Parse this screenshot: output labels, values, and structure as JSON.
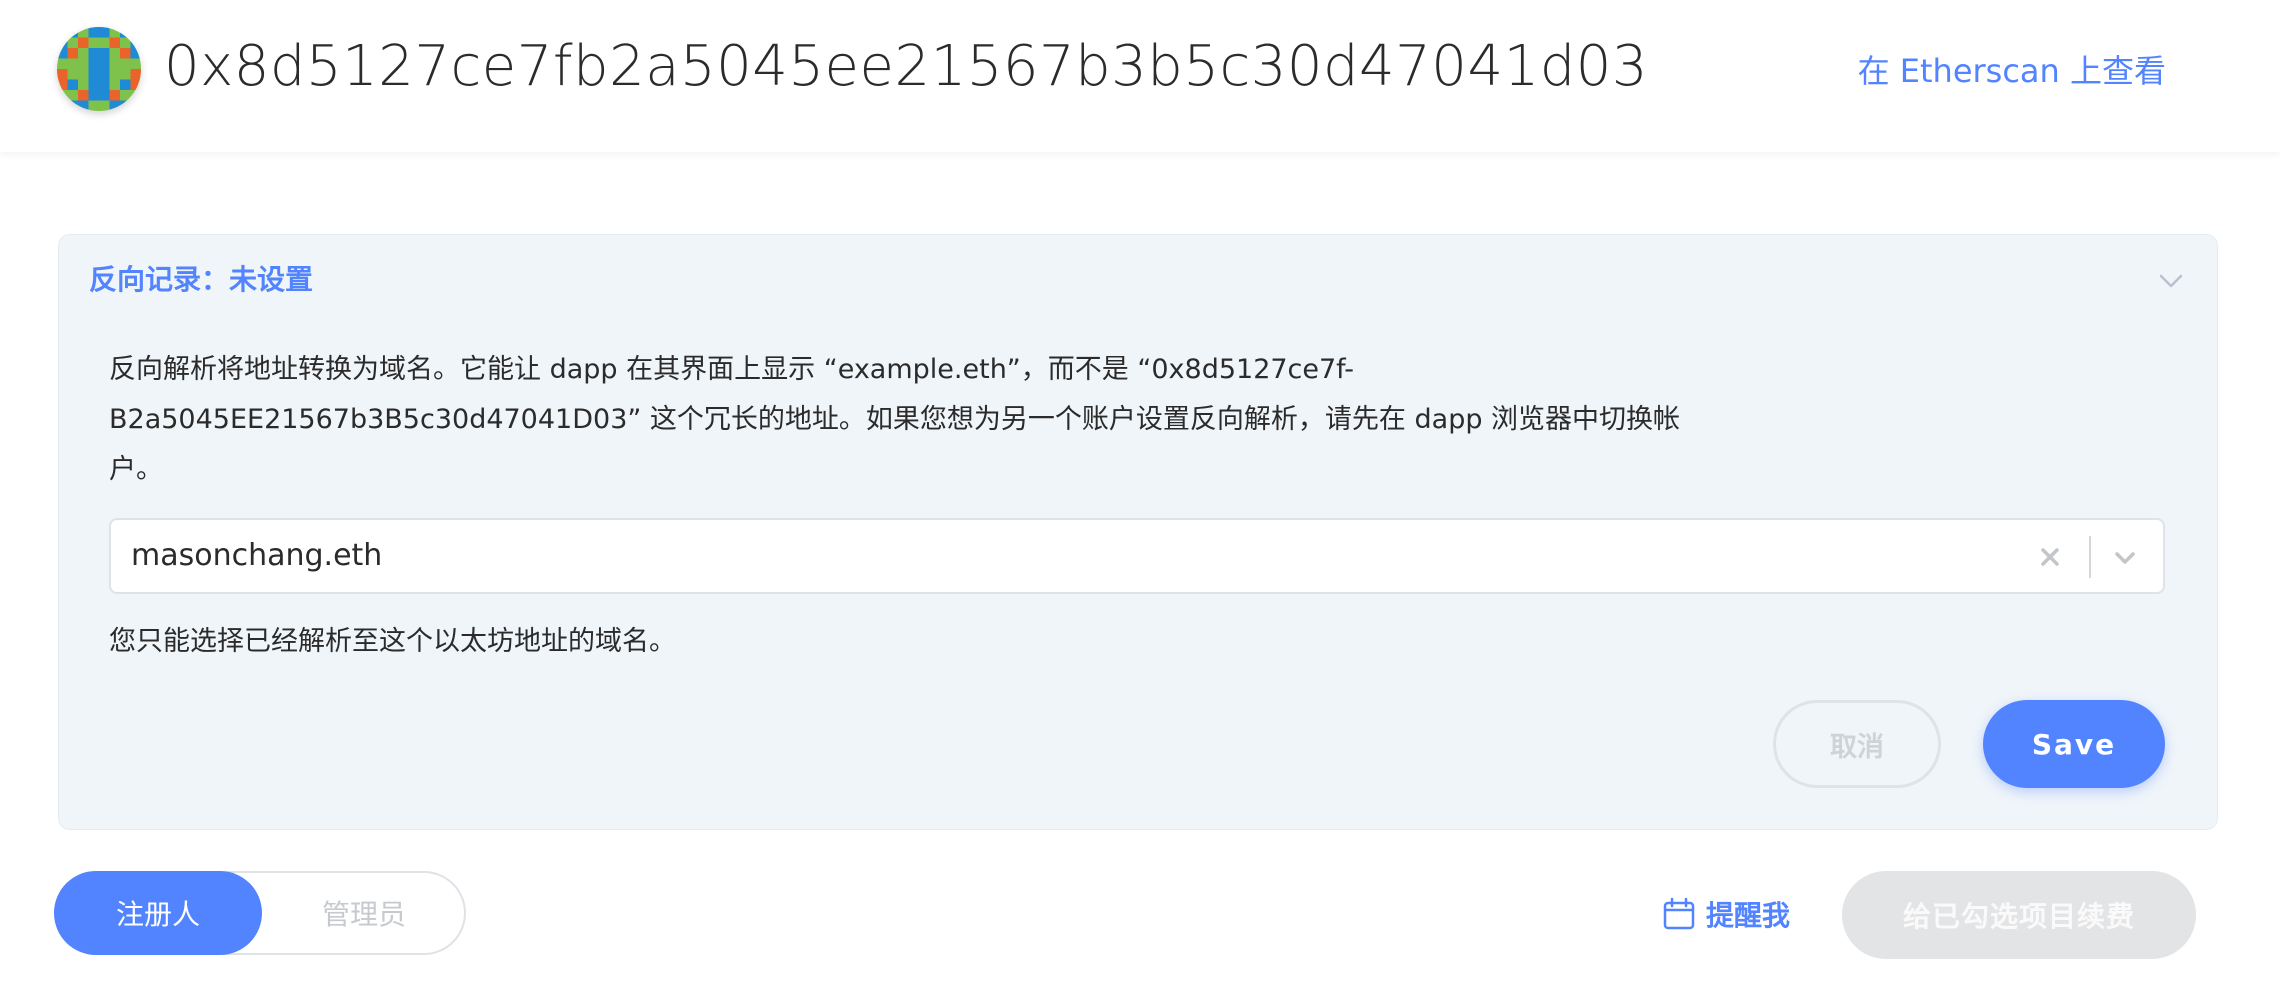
{
  "header": {
    "address": "0x8d5127ce7fb2a5045ee21567b3b5c30d47041d03",
    "etherscan_link": "在 Etherscan 上查看",
    "avatar_icon": "blockie-avatar-icon"
  },
  "reverse_record": {
    "title": "反向记录：未设置",
    "description": "反向解析将地址转换为域名。它能让 dapp 在其界面上显示 “example.eth”，而不是 “0x8d5127ce7f-B2a5045EE21567b3B5c30d47041D03” 这个冗长的地址。如果您想为另一个账户设置反向解析，请先在 dapp 浏览器中切换帐户。",
    "select": {
      "value": "masonchang.eth"
    },
    "hint": "您只能选择已经解析至这个以太坊地址的域名。",
    "cancel_label": "取消",
    "save_label": "Save"
  },
  "roles": {
    "registrant_label": "注册人",
    "controller_label": "管理员",
    "active": "registrant"
  },
  "actions": {
    "remind_label": "提醒我",
    "renew_label": "给已勾选项目续费"
  },
  "colors": {
    "accent": "#5284ff",
    "panel_bg": "#f0f5f9",
    "disabled_bg": "#e3e4e6"
  }
}
